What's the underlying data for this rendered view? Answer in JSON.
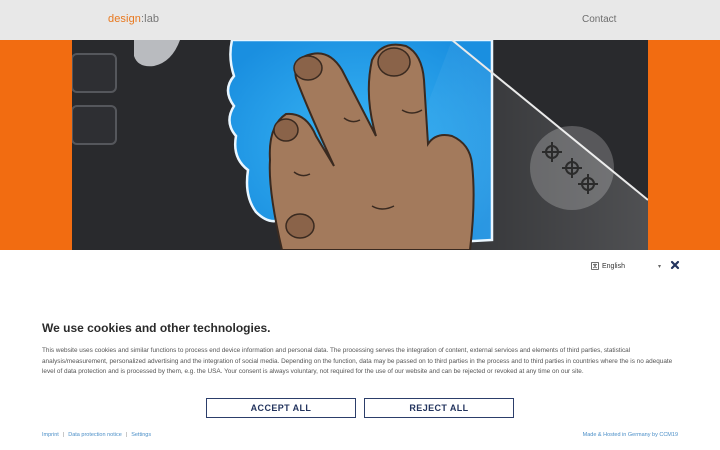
{
  "header": {
    "logo_part1": "design",
    "logo_part2": ":lab",
    "nav_contact": "Contact"
  },
  "hero": {
    "image_subject": "hand-on-touchscreen-illustration"
  },
  "cookie_banner": {
    "language": "English",
    "title": "We use cookies and other technologies.",
    "body": "This website uses cookies and similar functions to process end device information and personal data. The processing serves the integration of content, external services and elements of third parties, statistical analysis/measurement, personalized advertising and the integration of social media. Depending on the function, data may be passed on to third parties in the process and to third parties in countries where the is no adequate level of data protection and is processed by them, e.g. the USA. Your consent is always voluntary, not required for the use of our website and can be rejected or revoked at any time on our site.",
    "accept_label": "ACCEPT ALL",
    "reject_label": "REJECT ALL",
    "links": {
      "imprint": "Imprint",
      "data_protection": "Data protection notice",
      "settings": "Settings"
    },
    "made_by": "Made & Hosted in Germany by CCM19"
  },
  "colors": {
    "accent_orange": "#f26c11",
    "button_navy": "#23345e",
    "link_blue": "#4a8ec7"
  }
}
